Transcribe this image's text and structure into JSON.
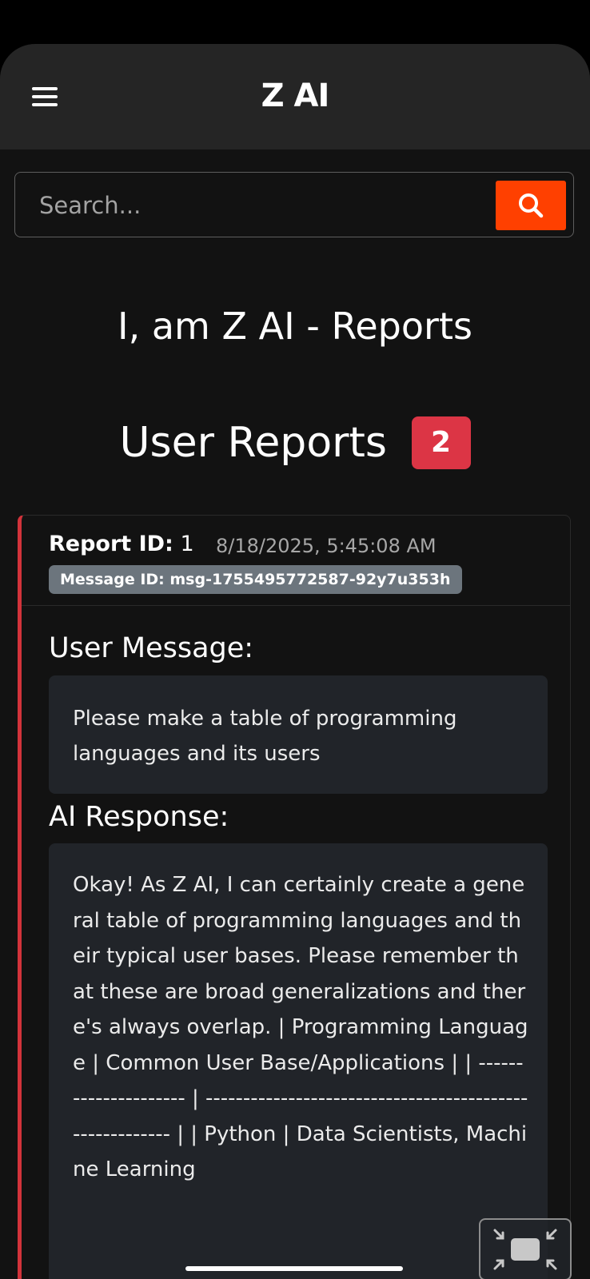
{
  "app": {
    "title": "Z AI"
  },
  "search": {
    "placeholder": "Search..."
  },
  "page": {
    "title": "I, am Z AI - Reports"
  },
  "reports_section": {
    "title": "User Reports",
    "count": "2"
  },
  "report": {
    "id_label": "Report ID:",
    "id_value": "1",
    "timestamp": "8/18/2025, 5:45:08 AM",
    "message_id": "Message ID: msg-1755495772587-92y7u353h",
    "user_message_label": "User Message:",
    "user_message": "Please make a table of programming languages and its users",
    "ai_response_label": "AI Response:",
    "ai_response": "Okay! As Z AI, I can certainly create a general table of programming languages and their typical user bases. Please remember that these are broad generalizations and there's always overlap. | Programming Language | Common User Base/Applications | | --------------------- | -------------------------------------------------------- | | Python | Data Scientists, Machine Learning"
  },
  "colors": {
    "accent": "#ff4000",
    "badge": "#dc3545",
    "card_border": "#d2333b",
    "message_badge": "#6c757d"
  },
  "icons": {
    "menu": "hamburger-menu-icon",
    "search": "search-icon",
    "float": "minimize-view-icon"
  }
}
